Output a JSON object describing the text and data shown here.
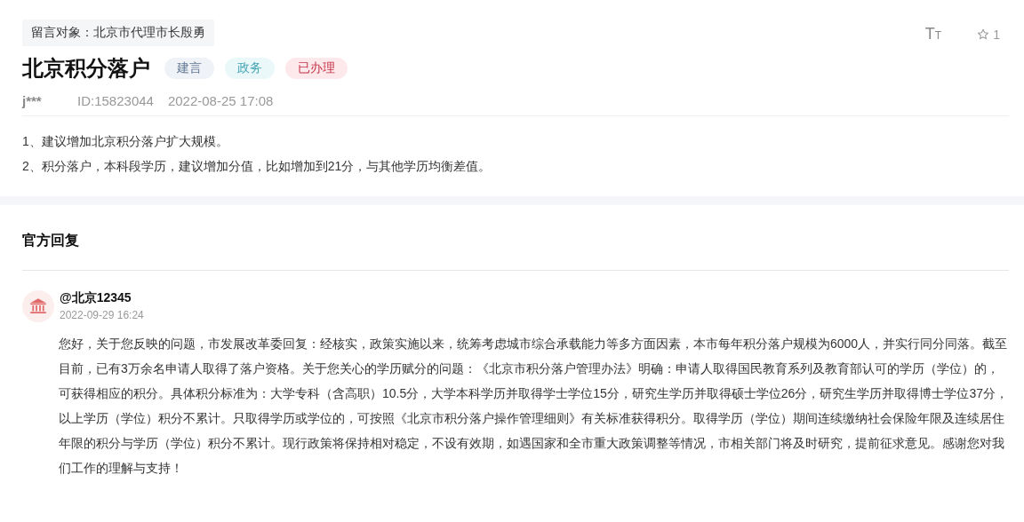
{
  "message": {
    "recipient": "留言对象：北京市代理市长殷勇",
    "title": "北京积分落户",
    "tags": [
      {
        "label": "建言",
        "color": "#eff2f6"
      },
      {
        "label": "政务",
        "color": "#eaf8fa"
      },
      {
        "label": "已办理",
        "color": "#fde9ec"
      }
    ],
    "font_size_toggle": "TT",
    "favorite_count": "1",
    "author": "j***",
    "id": "ID:15823044",
    "time": "2022-08-25 17:08",
    "body": [
      "1、建议增加北京积分落户扩大规模。",
      "2、积分落户，本科段学历，建议增加分值，比如增加到21分，与其他学历均衡差值。"
    ]
  },
  "reply": {
    "heading": "官方回复",
    "author": "@北京12345",
    "time": "2022-09-29 16:24",
    "text": "您好，关于您反映的问题，市发展改革委回复：经核实，政策实施以来，统筹考虑城市综合承载能力等多方面因素，本市每年积分落户规模为6000人，并实行同分同落。截至目前，已有3万余名申请人取得了落户资格。关于您关心的学历赋分的问题：《北京市积分落户管理办法》明确：申请人取得国民教育系列及教育部认可的学历（学位）的，可获得相应的积分。具体积分标准为：大学专科（含高职）10.5分，大学本科学历并取得学士学位15分，研究生学历并取得硕士学位26分，研究生学历并取得博士学位37分，以上学历（学位）积分不累计。只取得学历或学位的，可按照《北京市积分落户操作管理细则》有关标准获得积分。取得学历（学位）期间连续缴纳社会保险年限及连续居住年限的积分与学历（学位）积分不累计。现行政策将保持相对稳定，不设有效期，如遇国家和全市重大政策调整等情况，市相关部门将及时研究，提前征求意见。感谢您对我们工作的理解与支持！"
  }
}
